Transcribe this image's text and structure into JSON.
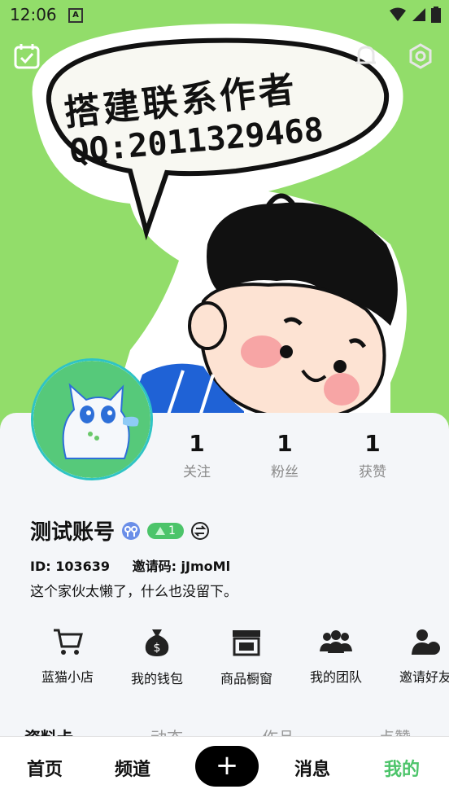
{
  "status_bar": {
    "time": "12:06",
    "a_icon": "A"
  },
  "header": {
    "left_icon": "calendar-check-icon",
    "bell_icon": "bell-icon",
    "settings_icon": "settings-icon"
  },
  "banner": {
    "bubble_line1": "搭建联系作者",
    "bubble_line2": "QQ:2011329468",
    "background": "#92dd6a"
  },
  "stats": [
    {
      "value": "1",
      "label": "关注"
    },
    {
      "value": "1",
      "label": "粉丝"
    },
    {
      "value": "1",
      "label": "获赞"
    }
  ],
  "profile": {
    "name": "测试账号",
    "level": "1",
    "id_label": "ID: 103639",
    "invite_label": "邀请码: jJmoMl",
    "bio": "这个家伙太懒了，什么也没留下。"
  },
  "actions": [
    {
      "label": "蓝猫小店",
      "icon": "cart-icon"
    },
    {
      "label": "我的钱包",
      "icon": "money-bag-icon"
    },
    {
      "label": "商品橱窗",
      "icon": "storefront-icon"
    },
    {
      "label": "我的团队",
      "icon": "team-icon"
    },
    {
      "label": "邀请好友",
      "icon": "invite-icon"
    }
  ],
  "tabs": [
    "资料卡",
    "动态",
    "作品",
    "点赞"
  ],
  "bottom_nav": {
    "home": "首页",
    "channel": "频道",
    "plus": "+",
    "messages": "消息",
    "mine": "我的"
  },
  "colors": {
    "accent_green": "#4cc46a",
    "avatar_ring": "#2fc4c4"
  }
}
